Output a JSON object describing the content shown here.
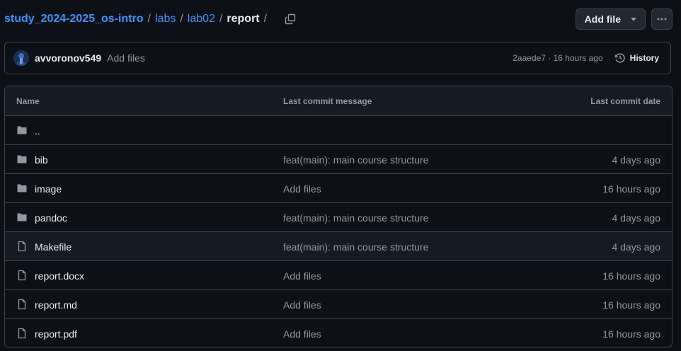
{
  "breadcrumb": {
    "repo": "study_2024-2025_os-intro",
    "parts": [
      "labs",
      "lab02"
    ],
    "current": "report",
    "separator": "/"
  },
  "actions": {
    "add_file_label": "Add file",
    "more_label": "···"
  },
  "latest_commit": {
    "author": "avvoronov549",
    "message": "Add files",
    "meta": "2aaede7 · 16 hours ago",
    "history_label": "History"
  },
  "table": {
    "headers": {
      "name": "Name",
      "message": "Last commit message",
      "date": "Last commit date"
    },
    "rows": [
      {
        "type": "folder",
        "name": "..",
        "message": "",
        "date": ""
      },
      {
        "type": "folder",
        "name": "bib",
        "message": "feat(main): main course structure",
        "date": "4 days ago"
      },
      {
        "type": "folder",
        "name": "image",
        "message": "Add files",
        "date": "16 hours ago"
      },
      {
        "type": "folder",
        "name": "pandoc",
        "message": "feat(main): main course structure",
        "date": "4 days ago"
      },
      {
        "type": "file",
        "name": "Makefile",
        "message": "feat(main): main course structure",
        "date": "4 days ago"
      },
      {
        "type": "file",
        "name": "report.docx",
        "message": "Add files",
        "date": "16 hours ago"
      },
      {
        "type": "file",
        "name": "report.md",
        "message": "Add files",
        "date": "16 hours ago"
      },
      {
        "type": "file",
        "name": "report.pdf",
        "message": "Add files",
        "date": "16 hours ago"
      }
    ]
  },
  "colors": {
    "background": "#0d1117",
    "link": "#4493f8",
    "border": "#3d444d",
    "muted": "#9198a1",
    "folder_icon": "#9198a1"
  },
  "icons": {
    "copy": "copy-icon",
    "history": "history-icon",
    "folder": "folder-icon",
    "file": "file-icon",
    "more": "kebab-horizontal-icon"
  }
}
